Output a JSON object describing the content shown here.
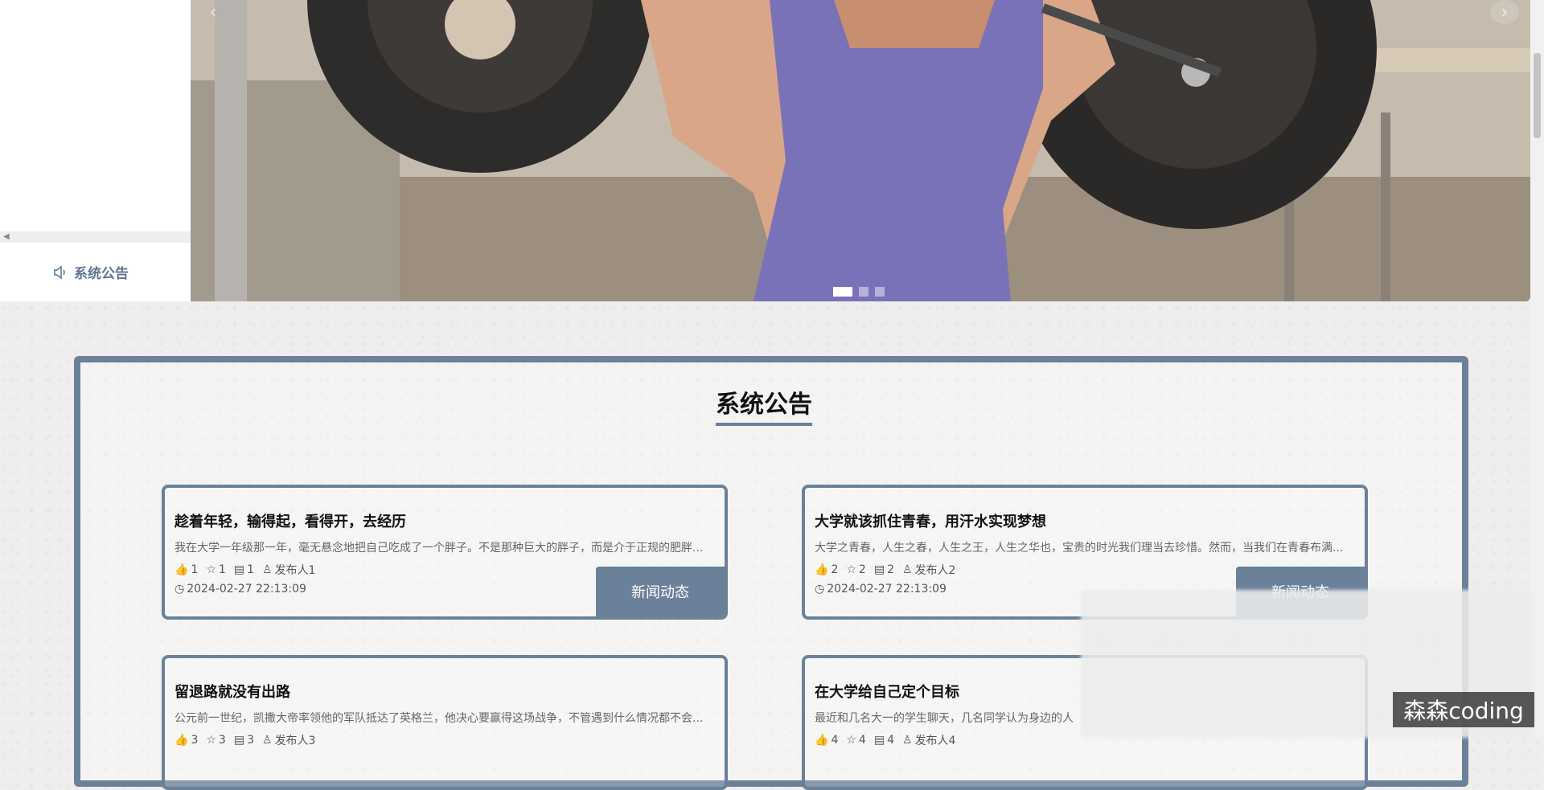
{
  "sidebar": {
    "notice_label": "系统公告",
    "notice_icon": "speaker-icon"
  },
  "carousel": {
    "prev": "‹",
    "next": "›",
    "slides": 3,
    "active": 1
  },
  "notice": {
    "title": "系统公告"
  },
  "cards": [
    {
      "title": "趁着年轻，输得起，看得开，去经历",
      "desc": "我在大学一年级那一年，毫无悬念地把自己吃成了一个胖子。不是那种巨大的胖子，而是介于正规的肥胖...",
      "likes": "1",
      "favs": "1",
      "comments": "1",
      "author": "发布人1",
      "date": "2024-02-27 22:13:09",
      "tag": "新闻动态"
    },
    {
      "title": "大学就该抓住青春，用汗水实现梦想",
      "desc": "大学之青春，人生之春，人生之王，人生之华也，宝贵的时光我们理当去珍惜。然而，当我们在青春布满...",
      "likes": "2",
      "favs": "2",
      "comments": "2",
      "author": "发布人2",
      "date": "2024-02-27 22:13:09",
      "tag": "新闻动态"
    },
    {
      "title": "留退路就没有出路",
      "desc": "公元前一世纪，凯撒大帝率领他的军队抵达了英格兰，他决心要赢得这场战争，不管遇到什么情况都不会...",
      "likes": "3",
      "favs": "3",
      "comments": "3",
      "author": "发布人3",
      "date": "",
      "tag": ""
    },
    {
      "title": "在大学给自己定个目标",
      "desc": "最近和几名大一的学生聊天，几名同学认为身边的人",
      "likes": "4",
      "favs": "4",
      "comments": "4",
      "author": "发布人4",
      "date": "",
      "tag": ""
    }
  ],
  "watermark": "森森coding",
  "colors": {
    "accent": "#6b819a",
    "background": "#efeeec"
  }
}
